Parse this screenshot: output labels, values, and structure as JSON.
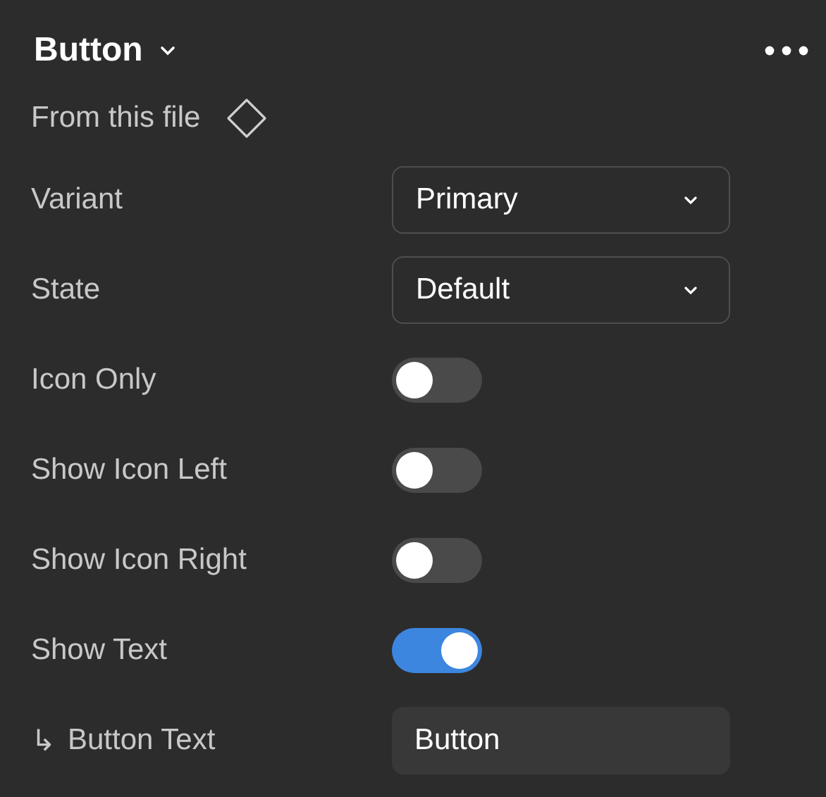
{
  "header": {
    "title": "Button",
    "source": "From this file"
  },
  "properties": [
    {
      "kind": "select",
      "label": "Variant",
      "value": "Primary"
    },
    {
      "kind": "select",
      "label": "State",
      "value": "Default"
    },
    {
      "kind": "toggle",
      "label": "Icon Only",
      "on": false
    },
    {
      "kind": "toggle",
      "label": "Show Icon Left",
      "on": false
    },
    {
      "kind": "toggle",
      "label": "Show Icon Right",
      "on": false
    },
    {
      "kind": "toggle",
      "label": "Show Text",
      "on": true
    },
    {
      "kind": "text",
      "prefix": "↳",
      "label": "Button Text",
      "value": "Button"
    }
  ]
}
